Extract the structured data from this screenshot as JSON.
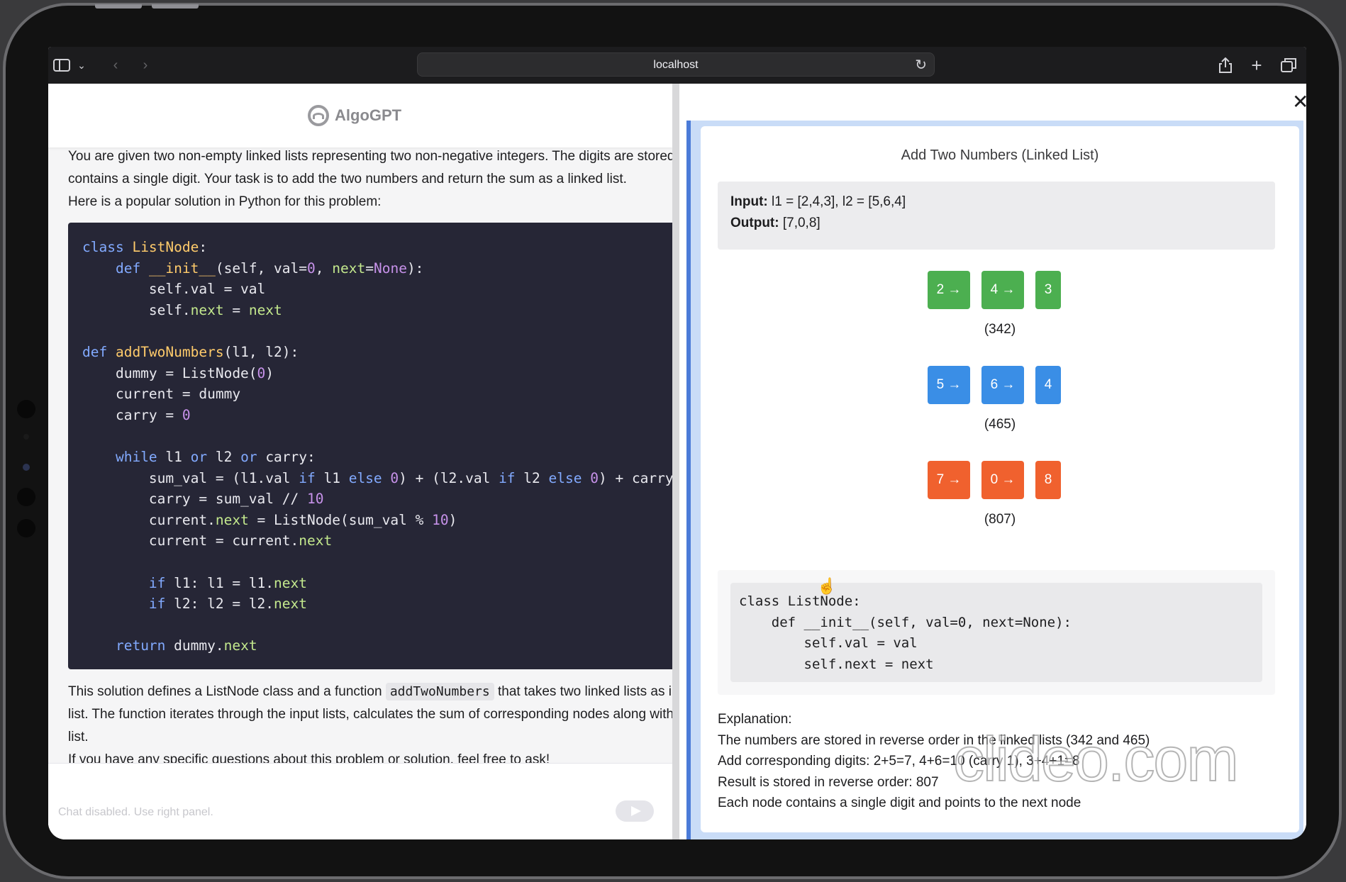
{
  "browser": {
    "url": "localhost"
  },
  "app": {
    "name": "AlgoGPT"
  },
  "chat": {
    "intro_lines": [
      "You are given two non-empty linked lists representing two non-negative integers. The digits are stored in reverse order, and each of their nodes",
      "contains a single digit. Your task is to add the two numbers and return the sum as a linked list.",
      "Here is a popular solution in Python for this problem:"
    ],
    "outro_line1_before": "This solution defines a ListNode class and a function",
    "outro_inline_code": "addTwoNumbers",
    "outro_line1_after": "that takes two linked lists as input",
    "outro_line2": "list. The function iterates through the input lists, calculates the sum of corresponding nodes along with the carry",
    "outro_line3": "list.",
    "outro_line4": "If you have any specific questions about this problem or solution, feel free to ask!",
    "input_placeholder": "Chat disabled. Use right panel."
  },
  "panel": {
    "title": "Add Two Numbers (Linked List)",
    "input_label": "Input:",
    "input_value": "l1 = [2,4,3], l2 = [5,6,4]",
    "output_label": "Output:",
    "output_value": "[7,0,8]",
    "lists": [
      {
        "nodes": [
          "2 →",
          "4 →",
          "3"
        ],
        "number": "(342)",
        "color": "#4caf50"
      },
      {
        "nodes": [
          "5 →",
          "6 →",
          "4"
        ],
        "number": "(465)",
        "color": "#3a8ee6"
      },
      {
        "nodes": [
          "7 →",
          "0 →",
          "8"
        ],
        "number": "(807)",
        "color": "#f0612e"
      }
    ],
    "code_lines": [
      "class ListNode:",
      "    def __init__(self, val=0, next=None):",
      "        self.val = val",
      "        self.next = next"
    ],
    "explanation": [
      "Explanation:",
      "The numbers are stored in reverse order in the linked lists (342 and 465)",
      "Add corresponding digits: 2+5=7, 4+6=10 (carry 1), 3+4+1=8",
      "Result is stored in reverse order: 807",
      "Each node contains a single digit and points to the next node"
    ]
  },
  "watermark": "clideo.com",
  "icons": {
    "sidebar": "sidebar-icon",
    "back": "chevron-left-icon",
    "forward": "chevron-right-icon",
    "reload": "reload-icon",
    "share": "share-icon",
    "new_tab": "plus-icon",
    "tabs": "tabs-icon",
    "close": "close-icon",
    "send": "send-icon"
  }
}
